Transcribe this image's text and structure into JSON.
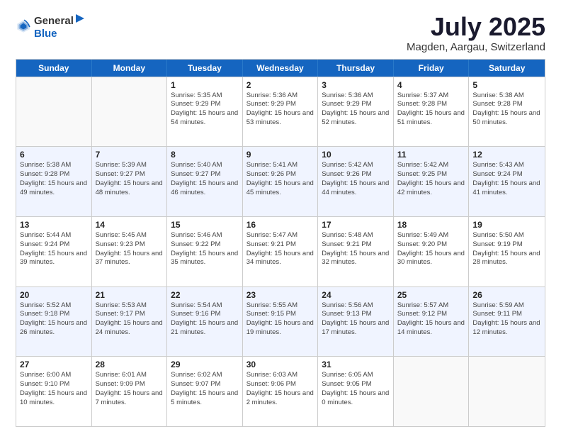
{
  "header": {
    "logo_general": "General",
    "logo_blue": "Blue",
    "month_title": "July 2025",
    "location": "Magden, Aargau, Switzerland"
  },
  "days_of_week": [
    "Sunday",
    "Monday",
    "Tuesday",
    "Wednesday",
    "Thursday",
    "Friday",
    "Saturday"
  ],
  "weeks": [
    [
      {
        "day": "",
        "sunrise": "",
        "sunset": "",
        "daylight": "",
        "empty": true
      },
      {
        "day": "",
        "sunrise": "",
        "sunset": "",
        "daylight": "",
        "empty": true
      },
      {
        "day": "1",
        "sunrise": "Sunrise: 5:35 AM",
        "sunset": "Sunset: 9:29 PM",
        "daylight": "Daylight: 15 hours and 54 minutes.",
        "empty": false
      },
      {
        "day": "2",
        "sunrise": "Sunrise: 5:36 AM",
        "sunset": "Sunset: 9:29 PM",
        "daylight": "Daylight: 15 hours and 53 minutes.",
        "empty": false
      },
      {
        "day": "3",
        "sunrise": "Sunrise: 5:36 AM",
        "sunset": "Sunset: 9:29 PM",
        "daylight": "Daylight: 15 hours and 52 minutes.",
        "empty": false
      },
      {
        "day": "4",
        "sunrise": "Sunrise: 5:37 AM",
        "sunset": "Sunset: 9:28 PM",
        "daylight": "Daylight: 15 hours and 51 minutes.",
        "empty": false
      },
      {
        "day": "5",
        "sunrise": "Sunrise: 5:38 AM",
        "sunset": "Sunset: 9:28 PM",
        "daylight": "Daylight: 15 hours and 50 minutes.",
        "empty": false
      }
    ],
    [
      {
        "day": "6",
        "sunrise": "Sunrise: 5:38 AM",
        "sunset": "Sunset: 9:28 PM",
        "daylight": "Daylight: 15 hours and 49 minutes.",
        "empty": false
      },
      {
        "day": "7",
        "sunrise": "Sunrise: 5:39 AM",
        "sunset": "Sunset: 9:27 PM",
        "daylight": "Daylight: 15 hours and 48 minutes.",
        "empty": false
      },
      {
        "day": "8",
        "sunrise": "Sunrise: 5:40 AM",
        "sunset": "Sunset: 9:27 PM",
        "daylight": "Daylight: 15 hours and 46 minutes.",
        "empty": false
      },
      {
        "day": "9",
        "sunrise": "Sunrise: 5:41 AM",
        "sunset": "Sunset: 9:26 PM",
        "daylight": "Daylight: 15 hours and 45 minutes.",
        "empty": false
      },
      {
        "day": "10",
        "sunrise": "Sunrise: 5:42 AM",
        "sunset": "Sunset: 9:26 PM",
        "daylight": "Daylight: 15 hours and 44 minutes.",
        "empty": false
      },
      {
        "day": "11",
        "sunrise": "Sunrise: 5:42 AM",
        "sunset": "Sunset: 9:25 PM",
        "daylight": "Daylight: 15 hours and 42 minutes.",
        "empty": false
      },
      {
        "day": "12",
        "sunrise": "Sunrise: 5:43 AM",
        "sunset": "Sunset: 9:24 PM",
        "daylight": "Daylight: 15 hours and 41 minutes.",
        "empty": false
      }
    ],
    [
      {
        "day": "13",
        "sunrise": "Sunrise: 5:44 AM",
        "sunset": "Sunset: 9:24 PM",
        "daylight": "Daylight: 15 hours and 39 minutes.",
        "empty": false
      },
      {
        "day": "14",
        "sunrise": "Sunrise: 5:45 AM",
        "sunset": "Sunset: 9:23 PM",
        "daylight": "Daylight: 15 hours and 37 minutes.",
        "empty": false
      },
      {
        "day": "15",
        "sunrise": "Sunrise: 5:46 AM",
        "sunset": "Sunset: 9:22 PM",
        "daylight": "Daylight: 15 hours and 35 minutes.",
        "empty": false
      },
      {
        "day": "16",
        "sunrise": "Sunrise: 5:47 AM",
        "sunset": "Sunset: 9:21 PM",
        "daylight": "Daylight: 15 hours and 34 minutes.",
        "empty": false
      },
      {
        "day": "17",
        "sunrise": "Sunrise: 5:48 AM",
        "sunset": "Sunset: 9:21 PM",
        "daylight": "Daylight: 15 hours and 32 minutes.",
        "empty": false
      },
      {
        "day": "18",
        "sunrise": "Sunrise: 5:49 AM",
        "sunset": "Sunset: 9:20 PM",
        "daylight": "Daylight: 15 hours and 30 minutes.",
        "empty": false
      },
      {
        "day": "19",
        "sunrise": "Sunrise: 5:50 AM",
        "sunset": "Sunset: 9:19 PM",
        "daylight": "Daylight: 15 hours and 28 minutes.",
        "empty": false
      }
    ],
    [
      {
        "day": "20",
        "sunrise": "Sunrise: 5:52 AM",
        "sunset": "Sunset: 9:18 PM",
        "daylight": "Daylight: 15 hours and 26 minutes.",
        "empty": false
      },
      {
        "day": "21",
        "sunrise": "Sunrise: 5:53 AM",
        "sunset": "Sunset: 9:17 PM",
        "daylight": "Daylight: 15 hours and 24 minutes.",
        "empty": false
      },
      {
        "day": "22",
        "sunrise": "Sunrise: 5:54 AM",
        "sunset": "Sunset: 9:16 PM",
        "daylight": "Daylight: 15 hours and 21 minutes.",
        "empty": false
      },
      {
        "day": "23",
        "sunrise": "Sunrise: 5:55 AM",
        "sunset": "Sunset: 9:15 PM",
        "daylight": "Daylight: 15 hours and 19 minutes.",
        "empty": false
      },
      {
        "day": "24",
        "sunrise": "Sunrise: 5:56 AM",
        "sunset": "Sunset: 9:13 PM",
        "daylight": "Daylight: 15 hours and 17 minutes.",
        "empty": false
      },
      {
        "day": "25",
        "sunrise": "Sunrise: 5:57 AM",
        "sunset": "Sunset: 9:12 PM",
        "daylight": "Daylight: 15 hours and 14 minutes.",
        "empty": false
      },
      {
        "day": "26",
        "sunrise": "Sunrise: 5:59 AM",
        "sunset": "Sunset: 9:11 PM",
        "daylight": "Daylight: 15 hours and 12 minutes.",
        "empty": false
      }
    ],
    [
      {
        "day": "27",
        "sunrise": "Sunrise: 6:00 AM",
        "sunset": "Sunset: 9:10 PM",
        "daylight": "Daylight: 15 hours and 10 minutes.",
        "empty": false
      },
      {
        "day": "28",
        "sunrise": "Sunrise: 6:01 AM",
        "sunset": "Sunset: 9:09 PM",
        "daylight": "Daylight: 15 hours and 7 minutes.",
        "empty": false
      },
      {
        "day": "29",
        "sunrise": "Sunrise: 6:02 AM",
        "sunset": "Sunset: 9:07 PM",
        "daylight": "Daylight: 15 hours and 5 minutes.",
        "empty": false
      },
      {
        "day": "30",
        "sunrise": "Sunrise: 6:03 AM",
        "sunset": "Sunset: 9:06 PM",
        "daylight": "Daylight: 15 hours and 2 minutes.",
        "empty": false
      },
      {
        "day": "31",
        "sunrise": "Sunrise: 6:05 AM",
        "sunset": "Sunset: 9:05 PM",
        "daylight": "Daylight: 15 hours and 0 minutes.",
        "empty": false
      },
      {
        "day": "",
        "sunrise": "",
        "sunset": "",
        "daylight": "",
        "empty": true
      },
      {
        "day": "",
        "sunrise": "",
        "sunset": "",
        "daylight": "",
        "empty": true
      }
    ]
  ]
}
